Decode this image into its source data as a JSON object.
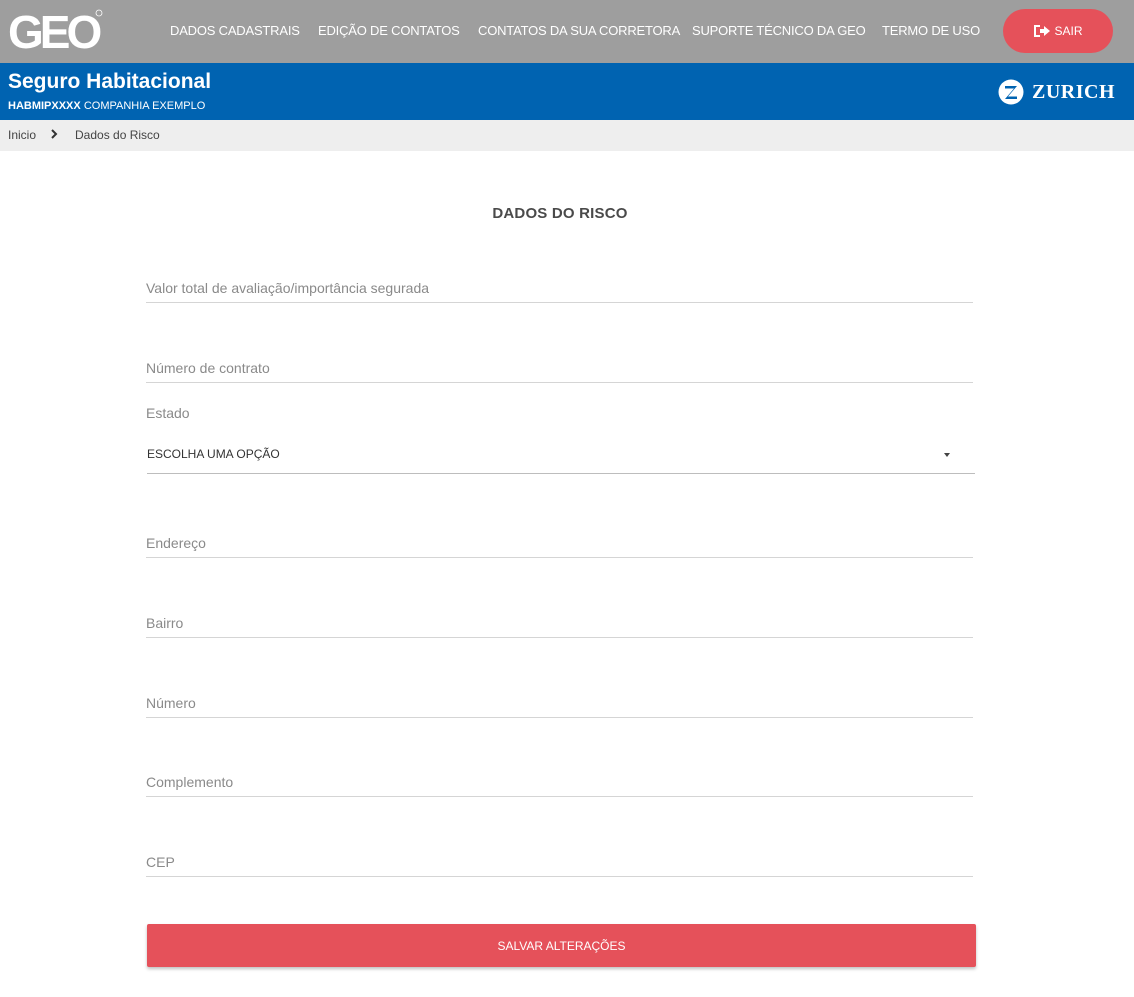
{
  "header": {
    "logo_text": "GEO",
    "nav": [
      {
        "label": "DADOS CADASTRAIS"
      },
      {
        "label": "EDIÇÃO DE CONTATOS"
      },
      {
        "label": "CONTATOS DA SUA CORRETORA"
      },
      {
        "label": "SUPORTE TÉCNICO DA GEO"
      },
      {
        "label": "TERMO DE USO"
      }
    ],
    "logout_label": "SAIR",
    "logout_icon": "sign-out-icon",
    "colors": {
      "topbar": "#9e9e9e",
      "logout": "#e5515a"
    }
  },
  "product": {
    "title": "Seguro Habitacional",
    "policy_code": "HABMIPXXXX",
    "company": "COMPANHIA EXEMPLO",
    "insurer": "ZURICH",
    "color": "#0063b1"
  },
  "breadcrumb": {
    "home": "Inicio",
    "separator_icon": "chevron-right-icon",
    "current": "Dados do Risco"
  },
  "form": {
    "title": "DADOS DO RISCO",
    "fields": {
      "valor": {
        "placeholder": "Valor total de avaliação/importância segurada",
        "value": ""
      },
      "contrato": {
        "placeholder": "Número de contrato",
        "value": ""
      },
      "endereco": {
        "placeholder": "Endereço",
        "value": ""
      },
      "bairro": {
        "placeholder": "Bairro",
        "value": ""
      },
      "numero": {
        "placeholder": "Número",
        "value": ""
      },
      "complemento": {
        "placeholder": "Complemento",
        "value": ""
      },
      "cep": {
        "placeholder": "CEP",
        "value": ""
      }
    },
    "estado": {
      "label": "Estado",
      "selected": "ESCOLHA UMA OPÇÃO"
    },
    "save_label": "SALVAR ALTERAÇÕES"
  }
}
